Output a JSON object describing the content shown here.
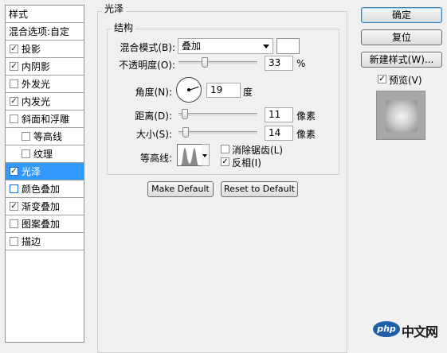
{
  "style_list": {
    "header": "样式",
    "blend_options": "混合选项:自定",
    "items": [
      {
        "label": "投影",
        "checked": true
      },
      {
        "label": "内阴影",
        "checked": true
      },
      {
        "label": "外发光",
        "checked": false
      },
      {
        "label": "内发光",
        "checked": true
      },
      {
        "label": "斜面和浮雕",
        "checked": false
      },
      {
        "label": "等高线",
        "checked": false
      },
      {
        "label": "纹理",
        "checked": false
      },
      {
        "label": "光泽",
        "checked": true,
        "selected": true
      },
      {
        "label": "颜色叠加",
        "checked": false
      },
      {
        "label": "渐变叠加",
        "checked": true
      },
      {
        "label": "图案叠加",
        "checked": false
      },
      {
        "label": "描边",
        "checked": false
      }
    ]
  },
  "satin": {
    "title": "光泽",
    "structure_title": "结构",
    "blend_mode_label": "混合模式(B):",
    "blend_mode_value": "叠加",
    "opacity_label": "不透明度(O):",
    "opacity_value": "33",
    "opacity_unit": "%",
    "angle_label": "角度(N):",
    "angle_value": "19",
    "angle_unit": "度",
    "distance_label": "距离(D):",
    "distance_value": "11",
    "distance_unit": "像素",
    "size_label": "大小(S):",
    "size_value": "14",
    "size_unit": "像素",
    "contour_label": "等高线:",
    "anti_aliased_label": "消除锯齿(L)",
    "anti_aliased_checked": false,
    "invert_label": "反相(I)",
    "invert_checked": true,
    "make_default": "Make Default",
    "reset_default": "Reset to Default"
  },
  "right_panel": {
    "ok": "确定",
    "reset": "复位",
    "new_style": "新建样式(W)...",
    "preview_label": "预览(V)",
    "preview_checked": true
  },
  "watermark": {
    "logo": "php",
    "text": "中文网"
  }
}
